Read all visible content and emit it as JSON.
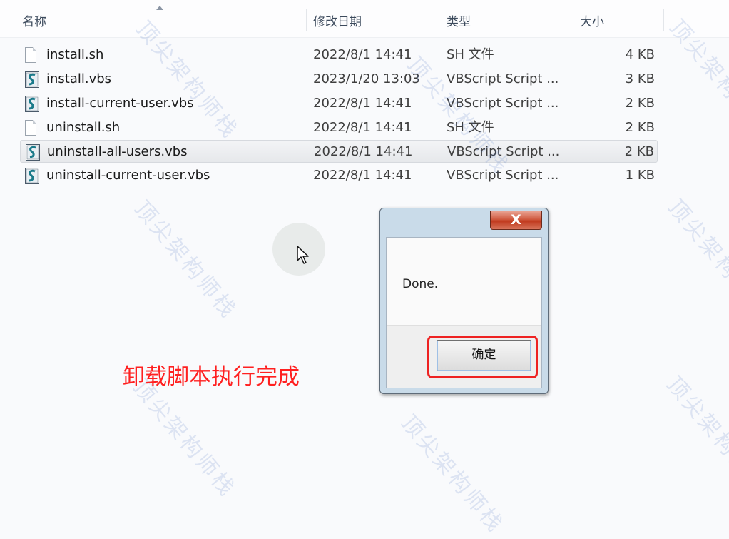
{
  "columns": {
    "name": "名称",
    "date": "修改日期",
    "type": "类型",
    "size": "大小"
  },
  "files": [
    {
      "name": "install.sh",
      "date": "2022/8/1 14:41",
      "type": "SH 文件",
      "size": "4 KB",
      "icon": "document-icon",
      "selected": false
    },
    {
      "name": "install.vbs",
      "date": "2023/1/20 13:03",
      "type": "VBScript Script ...",
      "size": "3 KB",
      "icon": "vbscript-icon",
      "selected": false
    },
    {
      "name": "install-current-user.vbs",
      "date": "2022/8/1 14:41",
      "type": "VBScript Script ...",
      "size": "2 KB",
      "icon": "vbscript-icon",
      "selected": false
    },
    {
      "name": "uninstall.sh",
      "date": "2022/8/1 14:41",
      "type": "SH 文件",
      "size": "2 KB",
      "icon": "document-icon",
      "selected": false
    },
    {
      "name": "uninstall-all-users.vbs",
      "date": "2022/8/1 14:41",
      "type": "VBScript Script ...",
      "size": "2 KB",
      "icon": "vbscript-icon",
      "selected": true
    },
    {
      "name": "uninstall-current-user.vbs",
      "date": "2022/8/1 14:41",
      "type": "VBScript Script ...",
      "size": "1 KB",
      "icon": "vbscript-icon",
      "selected": false
    }
  ],
  "dialog": {
    "close_label": "X",
    "message": "Done.",
    "ok_label": "确定"
  },
  "annotation": "卸载脚本执行完成",
  "watermark": "顶尖架构师栈",
  "colors": {
    "annotation": "#ff2020",
    "highlight_box": "#ee2222",
    "close_button": "#c0391d"
  }
}
